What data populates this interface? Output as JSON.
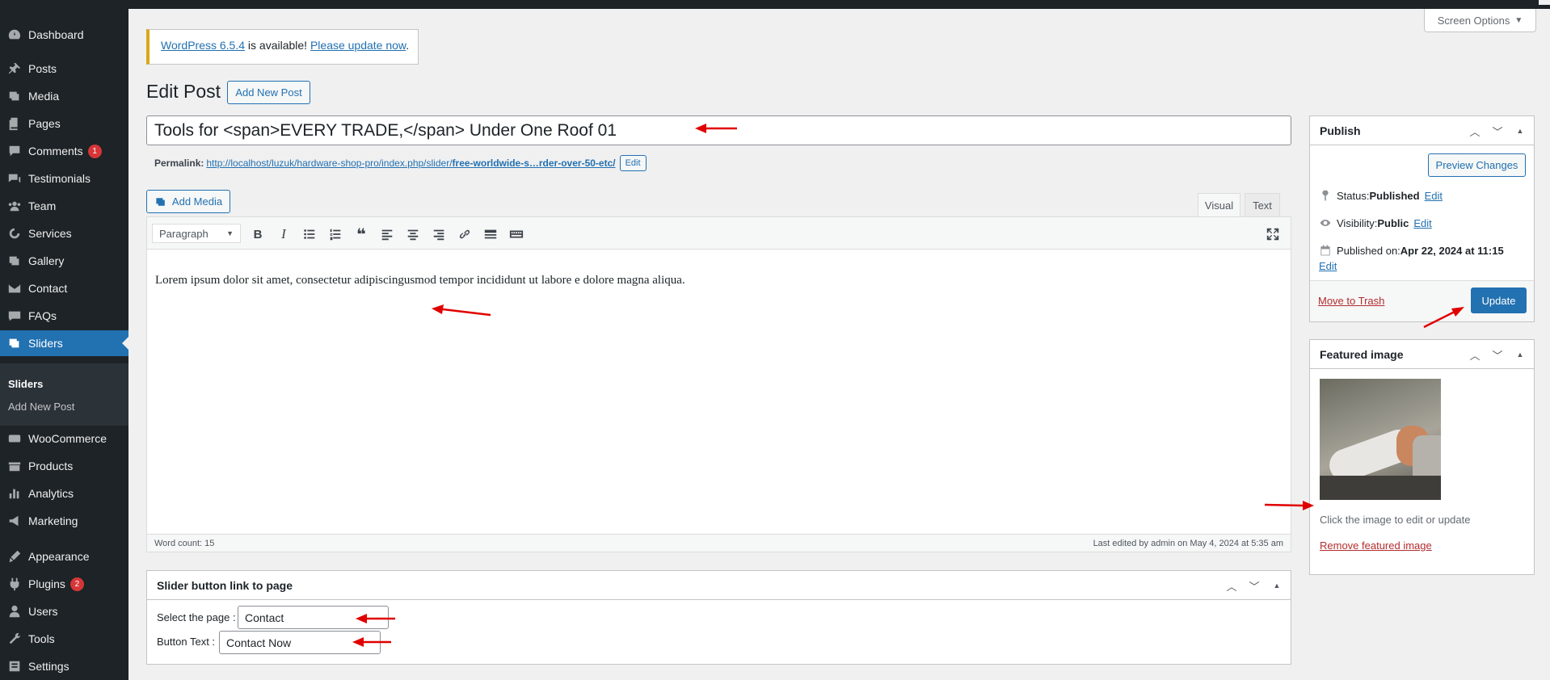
{
  "sidebar": {
    "items": [
      {
        "label": "Dashboard",
        "icon": "dashboard-icon"
      },
      {
        "label": "Posts",
        "icon": "pin-icon"
      },
      {
        "label": "Media",
        "icon": "media-icon"
      },
      {
        "label": "Pages",
        "icon": "pages-icon"
      },
      {
        "label": "Comments",
        "icon": "comments-icon",
        "badge": "1"
      },
      {
        "label": "Testimonials",
        "icon": "testimonials-icon"
      },
      {
        "label": "Team",
        "icon": "team-icon"
      },
      {
        "label": "Services",
        "icon": "services-icon"
      },
      {
        "label": "Gallery",
        "icon": "gallery-icon"
      },
      {
        "label": "Contact",
        "icon": "mail-icon"
      },
      {
        "label": "FAQs",
        "icon": "faq-icon"
      },
      {
        "label": "Sliders",
        "icon": "sliders-icon"
      },
      {
        "label": "WooCommerce",
        "icon": "woo-icon"
      },
      {
        "label": "Products",
        "icon": "products-icon"
      },
      {
        "label": "Analytics",
        "icon": "analytics-icon"
      },
      {
        "label": "Marketing",
        "icon": "marketing-icon"
      },
      {
        "label": "Appearance",
        "icon": "appearance-icon"
      },
      {
        "label": "Plugins",
        "icon": "plugins-icon",
        "badge": "2"
      },
      {
        "label": "Users",
        "icon": "users-icon"
      },
      {
        "label": "Tools",
        "icon": "tools-icon"
      },
      {
        "label": "Settings",
        "icon": "settings-icon"
      }
    ],
    "submenu": {
      "current": "Sliders",
      "add_new": "Add New Post"
    }
  },
  "header": {
    "screen_options": "Screen Options",
    "notice": {
      "link1": "WordPress 6.5.4",
      "text": " is available! ",
      "link2": "Please update now",
      "end": "."
    },
    "title": "Edit Post",
    "add_new": "Add New Post"
  },
  "post": {
    "title_value": "Tools for <span>EVERY TRADE,</span> Under One Roof 01",
    "permalink_label": "Permalink:",
    "permalink_base": "http://localhost/luzuk/hardware-shop-pro/index.php/slider/",
    "permalink_slug": "free-worldwide-s…rder-over-50-etc/",
    "permalink_edit": "Edit"
  },
  "editor": {
    "add_media": "Add Media",
    "tab_visual": "Visual",
    "tab_text": "Text",
    "format": "Paragraph",
    "content": "Lorem ipsum dolor sit amet, consectetur adipiscingusmod tempor incididunt ut labore e dolore magna aliqua.",
    "word_count": "Word count: 15",
    "last_edited": "Last edited by admin on May 4, 2024 at 5:35 am"
  },
  "slider_box": {
    "title": "Slider button link to page",
    "select_label": "Select the page :",
    "select_value": "Contact",
    "button_text_label": "Button Text :",
    "button_text_value": "Contact Now"
  },
  "publish": {
    "title": "Publish",
    "preview": "Preview Changes",
    "status_label": "Status: ",
    "status_value": "Published",
    "visibility_label": "Visibility: ",
    "visibility_value": "Public",
    "published_label": "Published on: ",
    "published_value": "Apr 22, 2024 at 11:15",
    "edit": "Edit",
    "trash": "Move to Trash",
    "update": "Update"
  },
  "featured": {
    "title": "Featured image",
    "hint": "Click the image to edit or update",
    "remove": "Remove featured image"
  },
  "colors": {
    "accent": "#2271b1",
    "sidebar": "#1d2327",
    "annotation": "#e00000",
    "badge": "#d63638"
  }
}
